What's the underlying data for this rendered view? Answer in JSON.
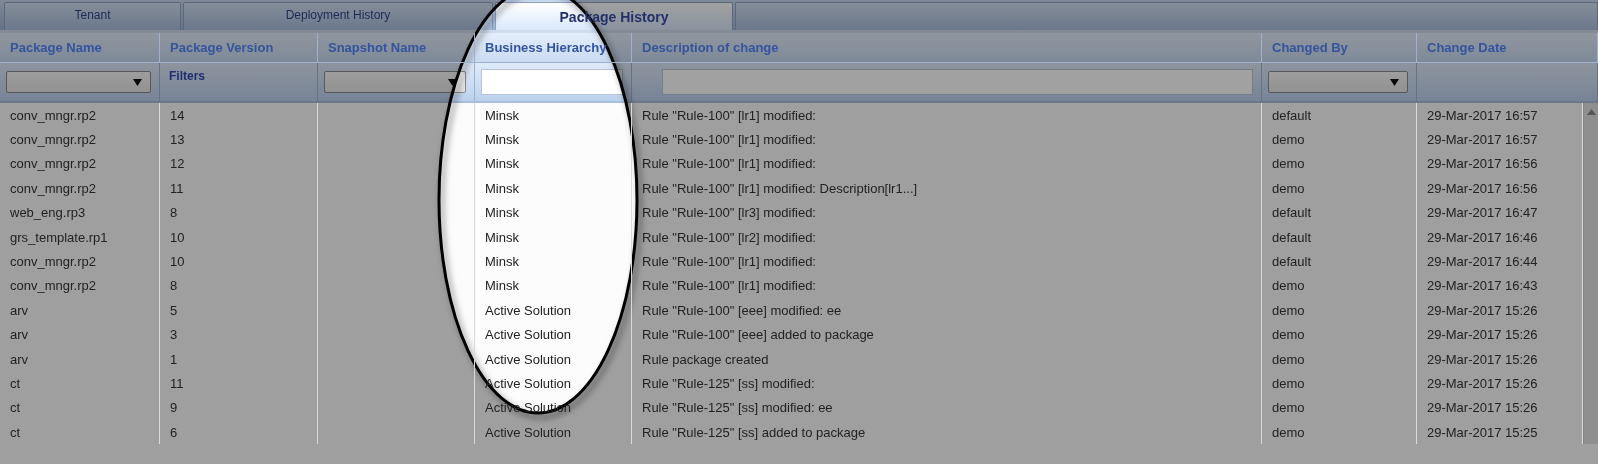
{
  "tabs": [
    {
      "label": "Tenant",
      "selected": false
    },
    {
      "label": "Deployment History",
      "selected": false
    },
    {
      "label": "Package History",
      "selected": true
    }
  ],
  "table": {
    "columns": [
      {
        "label": "Package Name",
        "filter": {
          "kind": "dropdown"
        }
      },
      {
        "label": "Package Version",
        "filter": {
          "kind": "label",
          "text": "Filters"
        }
      },
      {
        "label": "Snapshot Name",
        "filter": {
          "kind": "dropdown"
        }
      },
      {
        "label": "Business Hierarchy",
        "filter": {
          "kind": "text"
        }
      },
      {
        "label": "Description of change",
        "filter": {
          "kind": "text"
        }
      },
      {
        "label": "Changed By",
        "filter": {
          "kind": "dropdown"
        }
      },
      {
        "label": "Change Date"
      }
    ],
    "rows": [
      [
        "conv_mngr.rp2",
        "14",
        "",
        "Minsk",
        "Rule \"Rule-100\" [lr1] modified:",
        "default",
        "29-Mar-2017 16:57"
      ],
      [
        "conv_mngr.rp2",
        "13",
        "",
        "Minsk",
        "Rule \"Rule-100\" [lr1] modified:",
        "demo",
        "29-Mar-2017 16:57"
      ],
      [
        "conv_mngr.rp2",
        "12",
        "",
        "Minsk",
        "Rule \"Rule-100\" [lr1] modified:",
        "demo",
        "29-Mar-2017 16:56"
      ],
      [
        "conv_mngr.rp2",
        "11",
        "",
        "Minsk",
        "Rule \"Rule-100\" [lr1] modified: Description[lr1...]",
        "demo",
        "29-Mar-2017 16:56"
      ],
      [
        "web_eng.rp3",
        "8",
        "",
        "Minsk",
        "Rule \"Rule-100\" [lr3] modified:",
        "default",
        "29-Mar-2017 16:47"
      ],
      [
        "grs_template.rp1",
        "10",
        "",
        "Minsk",
        "Rule \"Rule-100\" [lr2] modified:",
        "default",
        "29-Mar-2017 16:46"
      ],
      [
        "conv_mngr.rp2",
        "10",
        "",
        "Minsk",
        "Rule \"Rule-100\" [lr1] modified:",
        "default",
        "29-Mar-2017 16:44"
      ],
      [
        "conv_mngr.rp2",
        "8",
        "",
        "Minsk",
        "Rule \"Rule-100\" [lr1] modified:",
        "demo",
        "29-Mar-2017 16:43"
      ],
      [
        "arv",
        "5",
        "",
        "Active Solution",
        "Rule \"Rule-100\" [eee] modified: ee",
        "demo",
        "29-Mar-2017 15:26"
      ],
      [
        "arv",
        "3",
        "",
        "Active Solution",
        "Rule \"Rule-100\" [eee] added to package",
        "demo",
        "29-Mar-2017 15:26"
      ],
      [
        "arv",
        "1",
        "",
        "Active Solution",
        "Rule package created",
        "demo",
        "29-Mar-2017 15:26"
      ],
      [
        "ct",
        "11",
        "",
        "Active Solution",
        "Rule \"Rule-125\" [ss] modified:",
        "demo",
        "29-Mar-2017 15:26"
      ],
      [
        "ct",
        "9",
        "",
        "Active Solution",
        "Rule \"Rule-125\" [ss] modified: ee",
        "demo",
        "29-Mar-2017 15:26"
      ],
      [
        "ct",
        "6",
        "",
        "Active Solution",
        "Rule \"Rule-125\" [ss] added to package",
        "demo",
        "29-Mar-2017 15:25"
      ]
    ]
  }
}
